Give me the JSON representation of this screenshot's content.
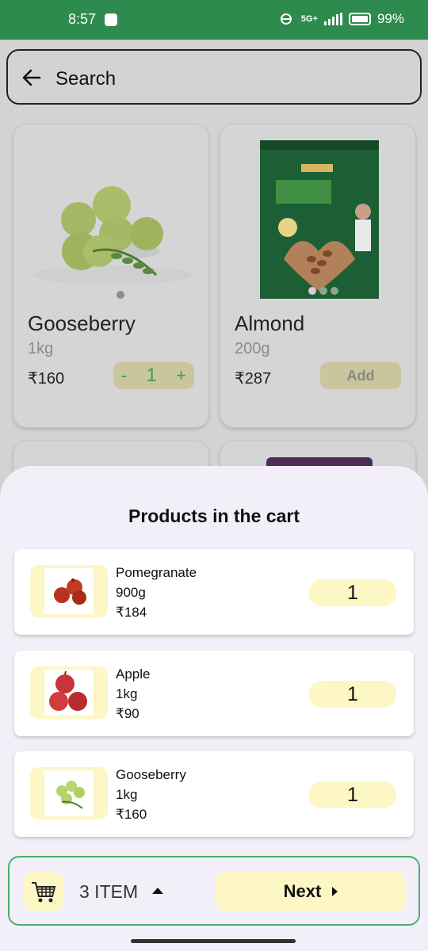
{
  "status_bar": {
    "time": "8:57",
    "network": "5G+",
    "battery": "99%"
  },
  "search": {
    "label": "Search"
  },
  "products": [
    {
      "name": "Gooseberry",
      "weight": "1kg",
      "price": "₹160",
      "qty": "1",
      "minus": "-",
      "plus": "+"
    },
    {
      "name": "Almond",
      "weight": "200g",
      "price": "₹287",
      "add_label": "Add"
    }
  ],
  "cart": {
    "title": "Products in the cart",
    "items": [
      {
        "name": "Pomegranate",
        "weight": "900g",
        "price": "₹184",
        "qty": "1"
      },
      {
        "name": "Apple",
        "weight": "1kg",
        "price": "₹90",
        "qty": "1"
      },
      {
        "name": "Gooseberry",
        "weight": "1kg",
        "price": "₹160",
        "qty": "1"
      }
    ]
  },
  "footer": {
    "items_label": "3 ITEM",
    "next_label": "Next"
  },
  "colors": {
    "status_bar": "#2e8b4e",
    "accent_yellow": "#fdf6c5",
    "footer_border": "#4caf6a",
    "sheet_bg": "#f3eff8"
  }
}
